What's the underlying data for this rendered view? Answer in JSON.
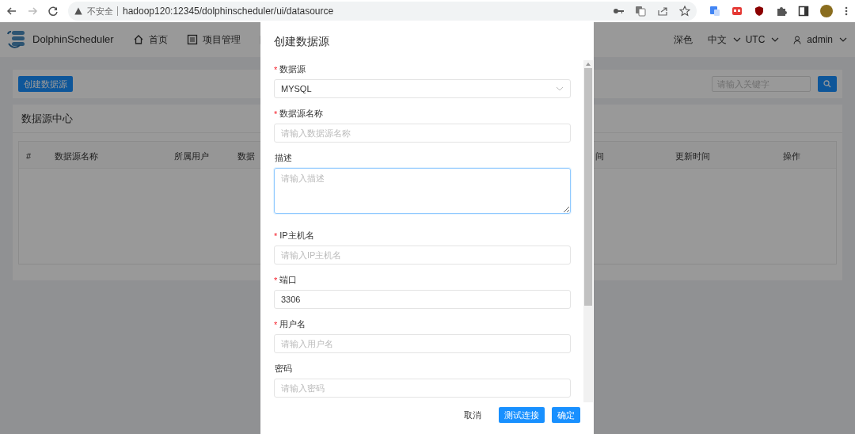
{
  "browser": {
    "back_enabled": true,
    "forward_enabled": false,
    "security_label": "不安全",
    "url": "hadoop120:12345/dolphinscheduler/ui/datasource"
  },
  "app_header": {
    "logo_text": "DolphinScheduler",
    "nav": [
      {
        "label": "首页",
        "kind": "home"
      },
      {
        "label": "项目管理",
        "kind": "project"
      },
      {
        "kind": "folder"
      }
    ],
    "theme": "深色",
    "language": "中文",
    "timezone": "UTC",
    "user": "admin"
  },
  "toolbar": {
    "create_button": "创建数据源",
    "search_placeholder": "请输入关键字"
  },
  "panel": {
    "title": "数据源中心",
    "columns": [
      "#",
      "数据源名称",
      "所属用户",
      "数据",
      "间",
      "更新时间",
      "操作"
    ]
  },
  "modal": {
    "title": "创建数据源",
    "required_mark": "*",
    "fields": [
      {
        "kind": "select",
        "label": "数据源",
        "required": true,
        "value": "MYSQL",
        "focused": false
      },
      {
        "kind": "input",
        "label": "数据源名称",
        "required": true,
        "placeholder": "请输入数据源名称",
        "focused": false
      },
      {
        "kind": "textarea",
        "label": "描述",
        "required": false,
        "placeholder": "请输入描述",
        "focused": true
      },
      {
        "kind": "input",
        "label": "IP主机名",
        "required": true,
        "placeholder": "请输入IP主机名",
        "focused": false
      },
      {
        "kind": "input",
        "label": "端口",
        "required": true,
        "value": "3306",
        "focused": false
      },
      {
        "kind": "input",
        "label": "用户名",
        "required": true,
        "placeholder": "请输入用户名",
        "focused": false
      },
      {
        "kind": "input",
        "label": "密码",
        "required": false,
        "placeholder": "请输入密码",
        "focused": false
      }
    ],
    "buttons": [
      {
        "kind": "text",
        "label": "取消"
      },
      {
        "kind": "primary",
        "label": "测试连接"
      },
      {
        "kind": "primary",
        "label": "确定"
      }
    ]
  }
}
